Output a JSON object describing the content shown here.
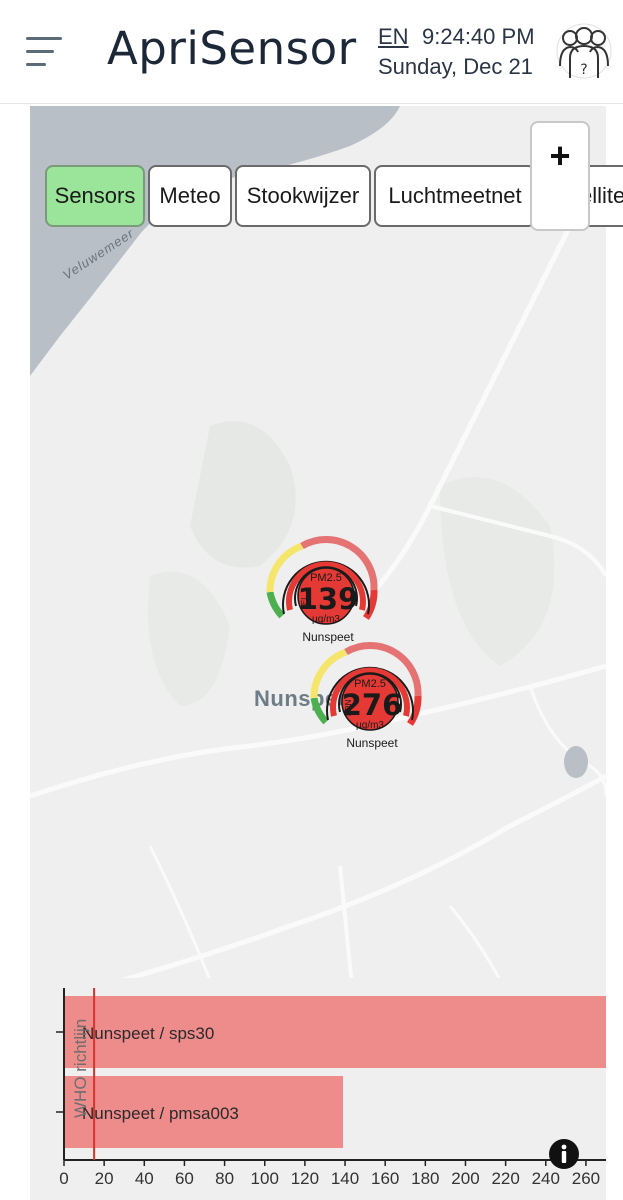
{
  "header": {
    "app_title": "ApriSensor",
    "language": "EN",
    "time": "9:24:40 PM",
    "date": "Sunday, Dec 21",
    "menu_icon": "hamburger-menu-icon",
    "user_icon": "users-help-icon"
  },
  "tabs": [
    {
      "label": "Sensors",
      "active": true
    },
    {
      "label": "Meteo",
      "active": false
    },
    {
      "label": "Stookwijzer",
      "active": false
    },
    {
      "label": "Luchtmeetnet",
      "active": false
    },
    {
      "label": "Satellite",
      "active": false
    }
  ],
  "map": {
    "zoom_in_label": "+",
    "lake_label": "Veluwemeer",
    "town_label": "Nunspeet"
  },
  "sensors": [
    {
      "pm_label": "PM2.5",
      "value": "139",
      "unit": "µg/m3",
      "source": "TEL",
      "name": "Nunspeet"
    },
    {
      "pm_label": "PM2.5",
      "value": "276",
      "unit": "µg/m3",
      "source": "FRN",
      "name": "Nunspeet"
    }
  ],
  "colors": {
    "active_tab": "#9be59b",
    "gauge_red": "#e53935",
    "gauge_yellow": "#f5e56b",
    "gauge_green": "#4caf50",
    "bar_fill": "#ee8b8b",
    "who_line": "#d9332b"
  },
  "chart_data": {
    "type": "bar",
    "orientation": "horizontal",
    "categories": [
      "Nunspeet / sps30",
      "Nunspeet / pmsa003"
    ],
    "values": [
      276,
      139
    ],
    "xlim": [
      0,
      270
    ],
    "xticks": [
      0,
      20,
      40,
      60,
      80,
      100,
      120,
      140,
      160,
      180,
      200,
      220,
      240,
      260
    ],
    "reference_line": {
      "label": "WHO richtlijn",
      "value": 15
    }
  },
  "info_icon": "info-icon"
}
